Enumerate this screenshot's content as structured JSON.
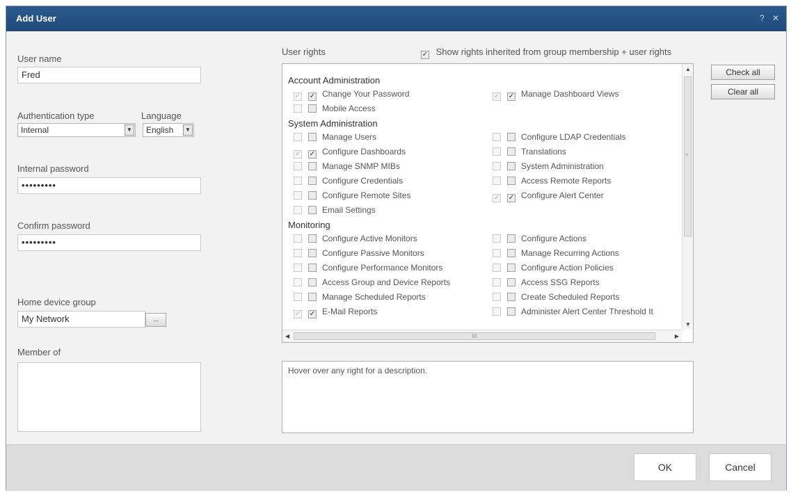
{
  "dialog": {
    "title": "Add User",
    "help_icon": "?",
    "close_icon": "✕"
  },
  "form": {
    "username_label": "User name",
    "username_value": "Fred",
    "auth_label": "Authentication type",
    "auth_value": "Internal",
    "language_label": "Language",
    "language_value": "English",
    "internal_password_label": "Internal password",
    "internal_password_value": "•••••••••",
    "confirm_password_label": "Confirm password",
    "confirm_password_value": "•••••••••",
    "home_group_label": "Home device group",
    "home_group_value": "My Network",
    "browse_label": "...",
    "member_of_label": "Member of"
  },
  "rights": {
    "label": "User rights",
    "inherited_label": "Show rights inherited from group membership + user rights",
    "inherited_checked": "✓",
    "check_all": "Check all",
    "clear_all": "Clear all",
    "description": "Hover over any right for a description.",
    "sections": {
      "account": "Account Administration",
      "system": "System Administration",
      "monitoring": "Monitoring"
    },
    "items": {
      "change_password": "Change Your Password",
      "manage_dashboard_views": "Manage Dashboard Views",
      "mobile_access": "Mobile Access",
      "manage_users": "Manage Users",
      "configure_ldap": "Configure LDAP Credentials",
      "configure_dashboards": "Configure Dashboards",
      "translations": "Translations",
      "manage_snmp": "Manage SNMP MIBs",
      "system_admin": "System Administration",
      "configure_credentials": "Configure Credentials",
      "access_remote_reports": "Access Remote Reports",
      "configure_remote_sites": "Configure Remote Sites",
      "configure_alert_center": "Configure Alert Center",
      "email_settings": "Email Settings",
      "configure_active_monitors": "Configure Active Monitors",
      "configure_actions": "Configure Actions",
      "configure_passive_monitors": "Configure Passive Monitors",
      "manage_recurring_actions": "Manage Recurring Actions",
      "configure_performance_monitors": "Configure Performance Monitors",
      "configure_action_policies": "Configure Action Policies",
      "access_group_device_reports": "Access Group and Device Reports",
      "access_ssg_reports": "Access SSG Reports",
      "manage_scheduled_reports": "Manage Scheduled Reports",
      "create_scheduled_reports": "Create Scheduled Reports",
      "email_reports": "E-Mail Reports",
      "administer_alert_center": "Administer Alert Center Threshold It"
    },
    "check": "✓",
    "scroll_h_label": "III",
    "scroll_v_label": "≡"
  },
  "footer": {
    "ok": "OK",
    "cancel": "Cancel"
  }
}
